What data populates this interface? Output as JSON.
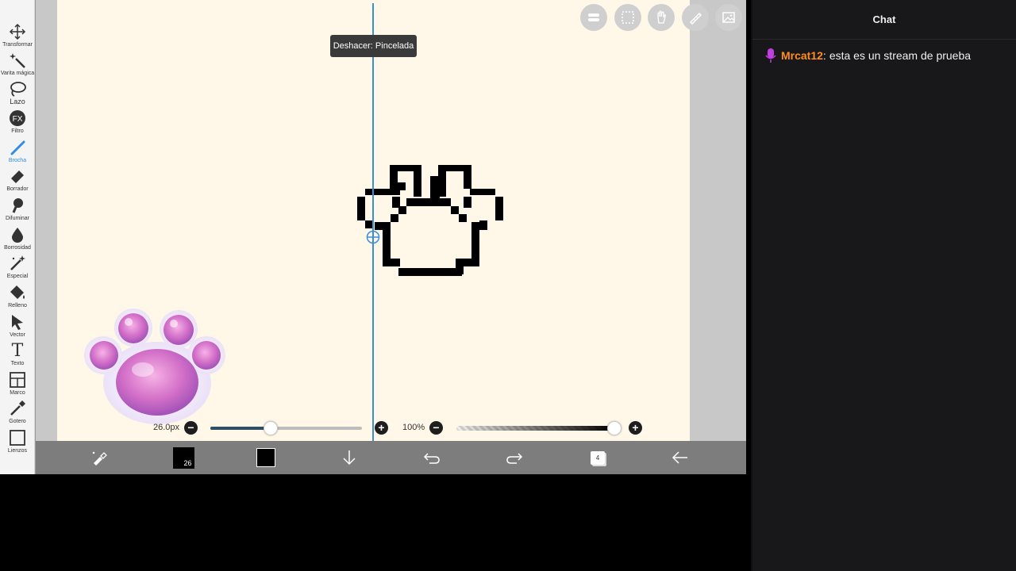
{
  "toolbar": {
    "tools": [
      {
        "label": "Transformar",
        "icon": "move-icon"
      },
      {
        "label": "Varita mágica",
        "icon": "magic-wand-icon"
      },
      {
        "label": "Lazo",
        "icon": "lasso-icon"
      },
      {
        "label": "Filtro",
        "icon": "fx-icon",
        "glyph": "FX"
      },
      {
        "label": "Brocha",
        "icon": "brush-icon",
        "active": true
      },
      {
        "label": "Borrador",
        "icon": "eraser-icon"
      },
      {
        "label": "Difuminar",
        "icon": "smudge-icon"
      },
      {
        "label": "Borrosidad",
        "icon": "blur-drop-icon"
      },
      {
        "label": "Especial",
        "icon": "special-wand-icon"
      },
      {
        "label": "Relleno",
        "icon": "fill-bucket-icon"
      },
      {
        "label": "Vector",
        "icon": "vector-arrow-icon"
      },
      {
        "label": "Texto",
        "icon": "text-icon",
        "glyph": "T"
      },
      {
        "label": "Marco",
        "icon": "frame-icon"
      },
      {
        "label": "Gotero",
        "icon": "eyedropper-icon"
      },
      {
        "label": "Lienzos",
        "icon": "canvas-icon"
      }
    ]
  },
  "canvas": {
    "tooltip": "Deshacer: Pincelada",
    "top_buttons": [
      "layers-toggle-icon",
      "selection-icon",
      "hand-icon",
      "ruler-icon",
      "reference-image-icon"
    ]
  },
  "brush_size": {
    "label": "26.0px",
    "value_fraction": 0.4
  },
  "opacity": {
    "label": "100%",
    "value_fraction": 1.0
  },
  "bottom_bar": {
    "brush_thumb_text": "26",
    "layer_count": "4",
    "brush_color": "#000000"
  },
  "chat": {
    "title": "Chat",
    "messages": [
      {
        "user": "Mrcat12",
        "separator": ":",
        "text": "esta es un stream de prueba",
        "user_color": "#ff8d1f",
        "badge": "microphone-icon"
      }
    ]
  },
  "colors": {
    "canvas_bg": "#fff7e7",
    "guide_line": "#3b8fd8",
    "chat_bg": "#18181b",
    "active_tool": "#2f8de4"
  }
}
